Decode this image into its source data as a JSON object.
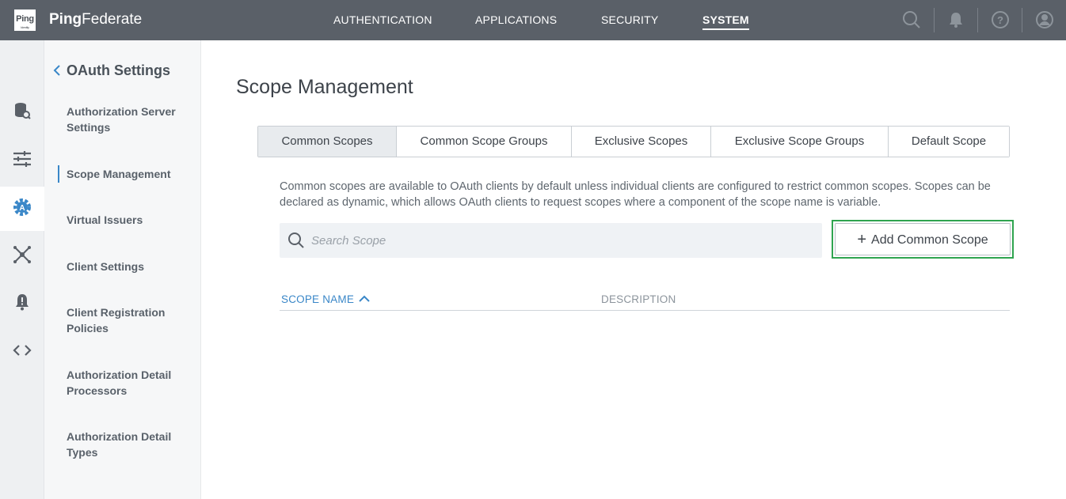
{
  "header": {
    "logo_text": "Ping",
    "logo_sub": "Identity",
    "brand_bold": "Ping",
    "brand_rest": "Federate",
    "nav": [
      {
        "label": "AUTHENTICATION",
        "active": false
      },
      {
        "label": "APPLICATIONS",
        "active": false
      },
      {
        "label": "SECURITY",
        "active": false
      },
      {
        "label": "SYSTEM",
        "active": true
      }
    ],
    "icons": [
      "search-icon",
      "bell-icon",
      "help-icon",
      "user-icon"
    ]
  },
  "rail": {
    "items": [
      {
        "icon": "database-icon",
        "active": false
      },
      {
        "icon": "sliders-icon",
        "active": false
      },
      {
        "icon": "gear-auth-icon",
        "active": true
      },
      {
        "icon": "network-icon",
        "active": false
      },
      {
        "icon": "alert-bell-icon",
        "active": false
      },
      {
        "icon": "code-icon",
        "active": false
      }
    ]
  },
  "subnav": {
    "title": "OAuth Settings",
    "items": [
      {
        "label": "Authorization Server Settings",
        "active": false
      },
      {
        "label": "Scope Management",
        "active": true
      },
      {
        "label": "Virtual Issuers",
        "active": false
      },
      {
        "label": "Client Settings",
        "active": false
      },
      {
        "label": "Client Registration Policies",
        "active": false
      },
      {
        "label": "Authorization Detail Processors",
        "active": false
      },
      {
        "label": "Authorization Detail Types",
        "active": false
      }
    ]
  },
  "main": {
    "title": "Scope Management",
    "tabs": [
      {
        "label": "Common Scopes",
        "active": true
      },
      {
        "label": "Common Scope Groups",
        "active": false
      },
      {
        "label": "Exclusive Scopes",
        "active": false
      },
      {
        "label": "Exclusive Scope Groups",
        "active": false
      },
      {
        "label": "Default Scope",
        "active": false
      }
    ],
    "description": "Common scopes are available to OAuth clients by default unless individual clients are configured to restrict common scopes. Scopes can be declared as dynamic, which allows OAuth clients to request scopes where a component of the scope name is variable.",
    "search": {
      "placeholder": "Search Scope",
      "value": ""
    },
    "add_button": {
      "plus": "+",
      "label": "Add Common Scope"
    },
    "table": {
      "columns": [
        {
          "label": "SCOPE NAME",
          "sort": "ascending"
        },
        {
          "label": "DESCRIPTION"
        }
      ],
      "rows": []
    }
  },
  "colors": {
    "topbar": "#5a6068",
    "accent_blue": "#3a87c8",
    "highlight_green": "#2fa44f"
  }
}
